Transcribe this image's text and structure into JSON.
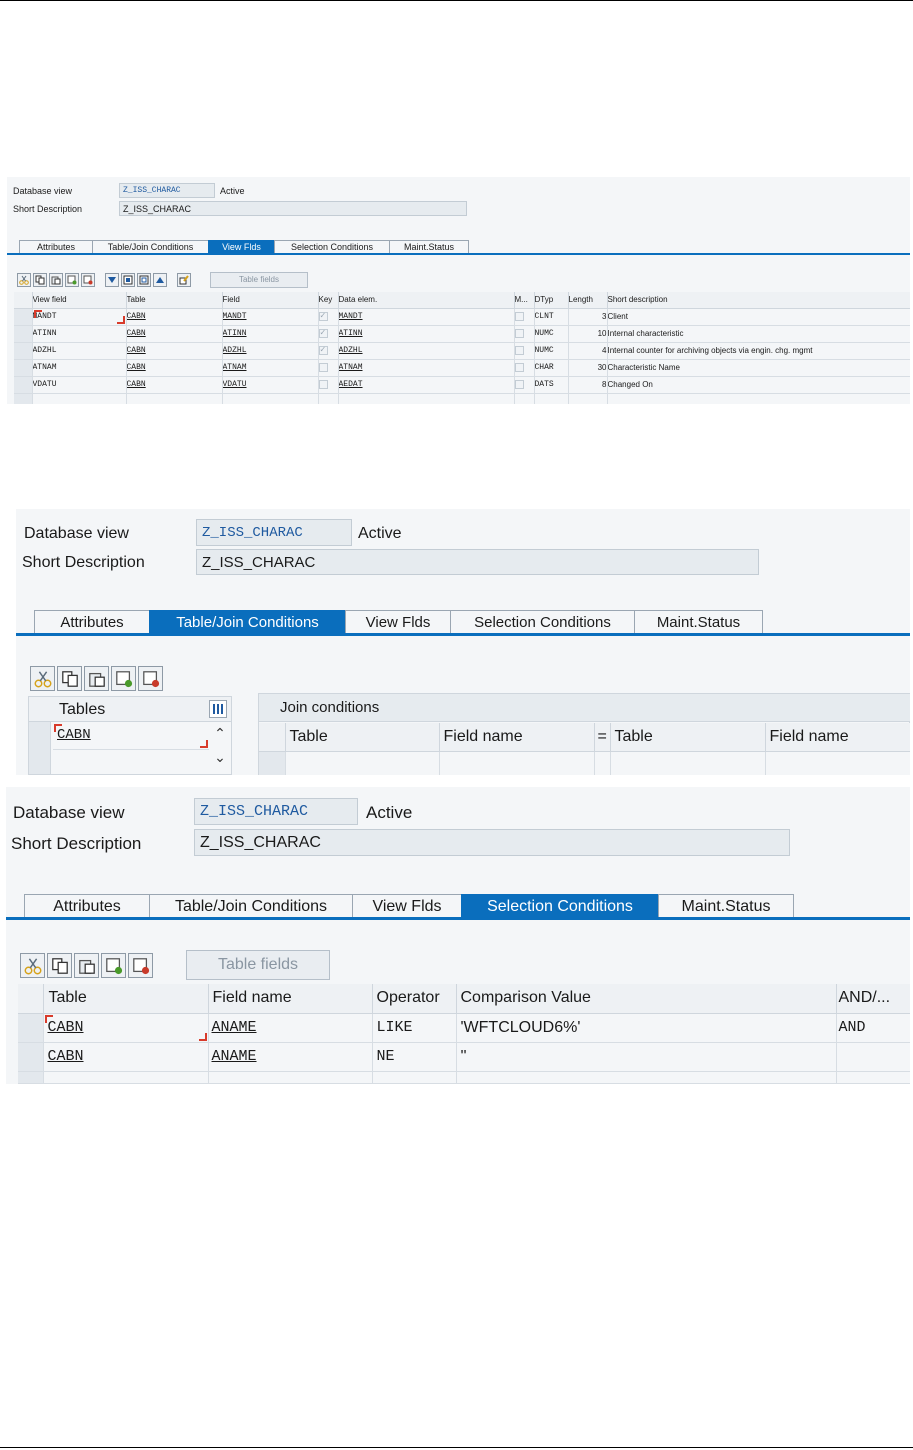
{
  "panel1": {
    "db_view_label": "Database view",
    "db_view_value": "Z_ISS_CHARAC",
    "status": "Active",
    "short_desc_label": "Short Description",
    "short_desc_value": "Z_ISS_CHARAC",
    "tabs": [
      "Attributes",
      "Table/Join Conditions",
      "View Flds",
      "Selection Conditions",
      "Maint.Status"
    ],
    "active_tab": "View Flds",
    "table_fields_button": "Table fields",
    "headers": [
      "View field",
      "Table",
      "Field",
      "Key",
      "Data elem.",
      "M...",
      "DTyp",
      "Length",
      "Short description"
    ],
    "rows": [
      {
        "view_field": "MANDT",
        "table": "CABN",
        "field": "MANDT",
        "key": true,
        "data_elem": "MANDT",
        "dtyp": "CLNT",
        "length": "3",
        "desc": "Client"
      },
      {
        "view_field": "ATINN",
        "table": "CABN",
        "field": "ATINN",
        "key": true,
        "data_elem": "ATINN",
        "dtyp": "NUMC",
        "length": "10",
        "desc": "Internal characteristic"
      },
      {
        "view_field": "ADZHL",
        "table": "CABN",
        "field": "ADZHL",
        "key": true,
        "data_elem": "ADZHL",
        "dtyp": "NUMC",
        "length": "4",
        "desc": "Internal counter for archiving objects via engin. chg. mgmt"
      },
      {
        "view_field": "ATNAM",
        "table": "CABN",
        "field": "ATNAM",
        "key": false,
        "data_elem": "ATNAM",
        "dtyp": "CHAR",
        "length": "30",
        "desc": "Characteristic Name"
      },
      {
        "view_field": "VDATU",
        "table": "CABN",
        "field": "VDATU",
        "key": false,
        "data_elem": "AEDAT",
        "dtyp": "DATS",
        "length": "8",
        "desc": "Changed On"
      }
    ]
  },
  "panel2": {
    "db_view_label": "Database view",
    "db_view_value": "Z_ISS_CHARAC",
    "status": "Active",
    "short_desc_label": "Short Description",
    "short_desc_value": "Z_ISS_CHARAC",
    "tabs": [
      "Attributes",
      "Table/Join Conditions",
      "View Flds",
      "Selection Conditions",
      "Maint.Status"
    ],
    "active_tab": "Table/Join Conditions",
    "tables_header": "Tables",
    "tables": [
      "CABN"
    ],
    "join_title": "Join conditions",
    "join_headers": [
      "Table",
      "Field name",
      "=",
      "Table",
      "Field name"
    ]
  },
  "panel3": {
    "db_view_label": "Database view",
    "db_view_value": "Z_ISS_CHARAC",
    "status": "Active",
    "short_desc_label": "Short Description",
    "short_desc_value": "Z_ISS_CHARAC",
    "tabs": [
      "Attributes",
      "Table/Join Conditions",
      "View Flds",
      "Selection Conditions",
      "Maint.Status"
    ],
    "active_tab": "Selection Conditions",
    "table_fields_button": "Table fields",
    "headers": [
      "Table",
      "Field name",
      "Operator",
      "Comparison Value",
      "AND/..."
    ],
    "rows": [
      {
        "table": "CABN",
        "field": "ANAME",
        "operator": "LIKE",
        "value": "'WFTCLOUD6%'",
        "andor": "AND"
      },
      {
        "table": "CABN",
        "field": "ANAME",
        "operator": "NE",
        "value": "''",
        "andor": ""
      }
    ]
  },
  "colors": {
    "active_tab": "#0a6ebd",
    "panel_bg": "#f4f6f8",
    "field_bg": "#e6ebef",
    "key_blue": "#1f5aa0",
    "focus_red": "#d83b2b"
  }
}
